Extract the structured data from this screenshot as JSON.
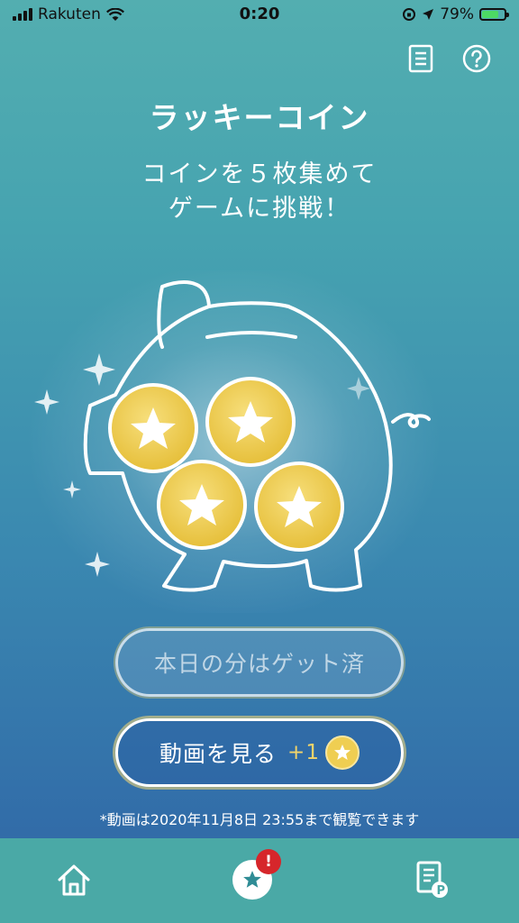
{
  "status_bar": {
    "carrier": "Rakuten",
    "time": "0:20",
    "battery": "79%"
  },
  "header": {
    "title": "ラッキーコイン",
    "subtitle_line1": "コインを５枚集めて",
    "subtitle_line2": "ゲームに挑戦！"
  },
  "buttons": {
    "done_label": "本日の分はゲット済",
    "video_label": "動画を見る",
    "video_bonus": "+1"
  },
  "note": "*動画は2020年11月8日 23:55まで観覧できます",
  "tabbar": {
    "badge": "!"
  },
  "coins_collected": 4,
  "colors": {
    "coin": "#efce52",
    "badge": "#d6262b",
    "tabbar": "#4aa9a6"
  }
}
